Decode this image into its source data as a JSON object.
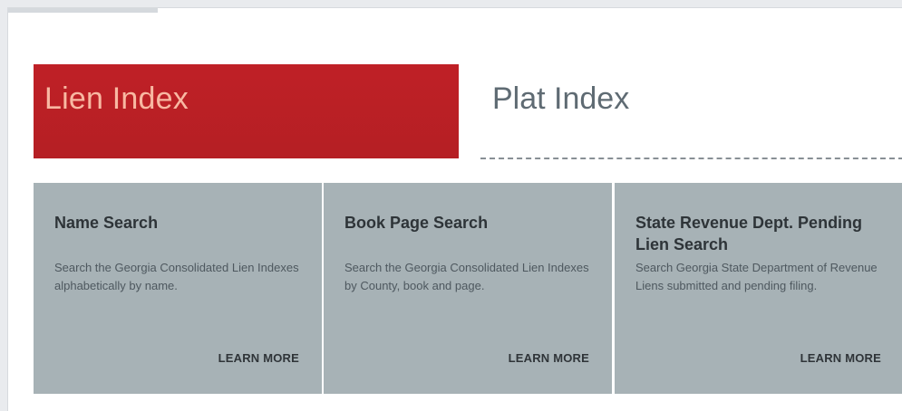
{
  "tabs": [
    {
      "label": "Lien Index",
      "active": true
    },
    {
      "label": "Plat Index",
      "active": false
    }
  ],
  "cards": [
    {
      "title": "Name Search",
      "description": "Search the Georgia Consolidated Lien Indexes alphabetically by name.",
      "link_label": "LEARN MORE"
    },
    {
      "title": "Book Page Search",
      "description": "Search the Georgia Consolidated Lien Indexes by County, book and page.",
      "link_label": "LEARN MORE"
    },
    {
      "title": "State Revenue Dept. Pending Lien Search",
      "description": "Search Georgia State Department of Revenue Liens submitted and pending filing.",
      "link_label": "LEARN MORE"
    }
  ],
  "colors": {
    "active_tab_bg": "#bf2026",
    "active_tab_text": "#f8b8a2",
    "inactive_tab_text": "#5f6b73",
    "card_bg": "#a7b2b6"
  }
}
